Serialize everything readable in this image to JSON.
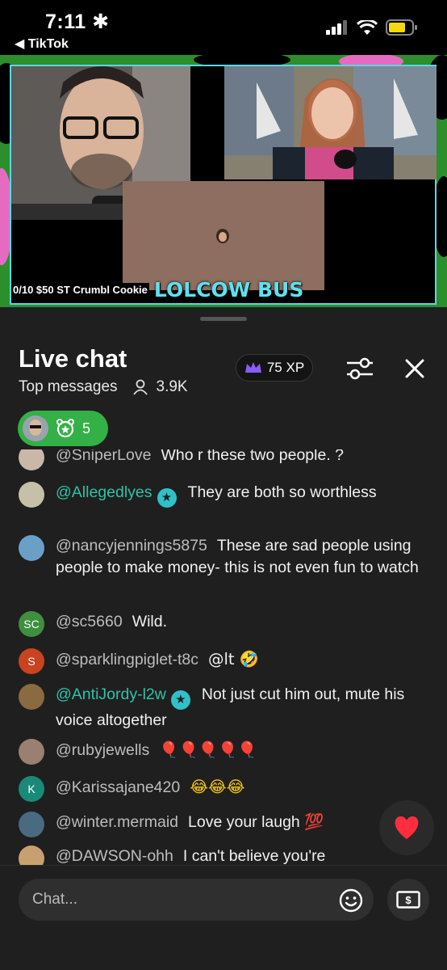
{
  "status_bar": {
    "time": "7:11",
    "back_label": "◀ TikTok"
  },
  "video": {
    "ticker": "0/10 $50 ST Crumbl Cookie",
    "logo": "LOLCOW BUS"
  },
  "live_chat": {
    "title": "Live chat",
    "filter_label": "Top messages",
    "viewers": "3.9K",
    "xp_label": "75 XP",
    "team_count": "5"
  },
  "messages": [
    {
      "user": "@SniperLove",
      "text": "Who r these two people. ?",
      "avatar_color": "#c9b7a8",
      "subscriber": false
    },
    {
      "user": "@Allegedlyes",
      "text": "They are both so worthless",
      "avatar_color": "#c6c0a8",
      "subscriber": true
    },
    {
      "user": "@nancyjennings5875",
      "text": "These are sad people using people to make money- this is not even fun to watch",
      "avatar_color": "#6aa0c8",
      "subscriber": false
    },
    {
      "user": "@sc5660",
      "text": "Wild.",
      "avatar_initials": "SC",
      "avatar_color": "#3e8f3e",
      "subscriber": false
    },
    {
      "user": "@sparklingpiglet-t8c",
      "text": "@lt 🤣",
      "avatar_initials": "S",
      "avatar_color": "#c8431f",
      "subscriber": false
    },
    {
      "user": "@AntiJordy-l2w",
      "text": "Not just cut him out, mute his voice altogether",
      "avatar_color": "#8a6a40",
      "subscriber": true
    },
    {
      "user": "@rubyjewells",
      "text": "🎈🎈🎈🎈🎈",
      "avatar_color": "#9a8070",
      "subscriber": false
    },
    {
      "user": "@Karissajane420",
      "text": "😂😂😂",
      "avatar_initials": "K",
      "avatar_color": "#1a8a78",
      "subscriber": false
    },
    {
      "user": "@winter.mermaid",
      "text": "Love your laugh 💯",
      "avatar_color": "#4a6a80",
      "subscriber": false
    },
    {
      "user": "@DAWSON-ohh",
      "text": "I can't believe you're",
      "avatar_color": "#c8a070",
      "subscriber": false
    }
  ],
  "input": {
    "placeholder": "Chat..."
  },
  "colors": {
    "accent_green": "#33b046",
    "subscriber_teal": "#2fc1a8",
    "sheet_bg": "#1f1f1f"
  }
}
